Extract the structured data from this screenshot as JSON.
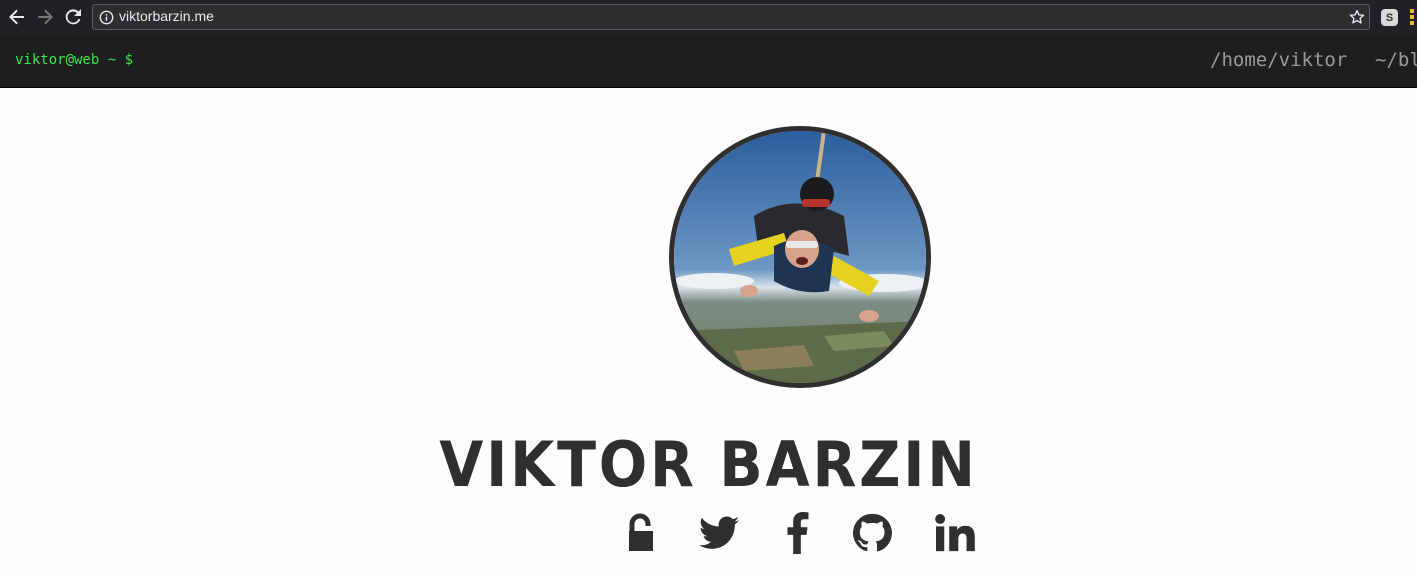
{
  "browser": {
    "url": "viktorbarzin.me",
    "extension_badge": "S",
    "icons": [
      "back-arrow-icon",
      "forward-arrow-icon",
      "reload-icon",
      "info-icon",
      "star-icon",
      "menu-icon"
    ]
  },
  "header": {
    "prompt": "viktor@web ~ $",
    "links": [
      {
        "label": "/home/viktor"
      },
      {
        "label": "~/bl"
      }
    ]
  },
  "profile": {
    "name": "VIKTOR BARZIN",
    "avatar": "avatar-skydiving-photo"
  },
  "social": [
    {
      "name": "lock-icon"
    },
    {
      "name": "twitter-icon"
    },
    {
      "name": "facebook-icon"
    },
    {
      "name": "github-icon"
    },
    {
      "name": "linkedin-icon"
    }
  ],
  "colors": {
    "prompt": "#37e84a",
    "header_bg": "#1e1e1e",
    "text": "#2f2f2f",
    "page_bg": "#fdfdfd"
  }
}
